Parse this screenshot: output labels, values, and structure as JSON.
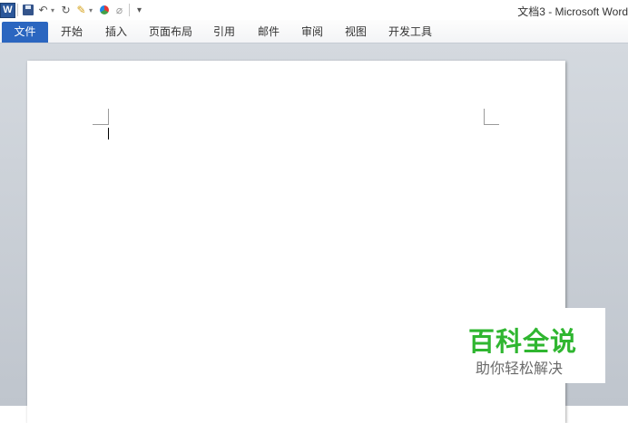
{
  "window": {
    "title": "文档3 - Microsoft Word"
  },
  "qat": {
    "app_icon": "word-logo-icon",
    "app_letter": "W",
    "items": [
      "save-icon",
      "undo-icon",
      "redo-icon",
      "format-painter-icon",
      "color-icon",
      "clear-format-icon",
      "customize-icon"
    ]
  },
  "ribbon": {
    "file_tab": "文件",
    "tabs": [
      "开始",
      "插入",
      "页面布局",
      "引用",
      "邮件",
      "审阅",
      "视图",
      "开发工具"
    ]
  },
  "watermark": {
    "main": "百科全说",
    "sub": "助你轻松解决"
  },
  "colors": {
    "file_tab": "#2b66c0",
    "watermark_green": "#2fb630",
    "doc_background": "#c9ced5"
  }
}
